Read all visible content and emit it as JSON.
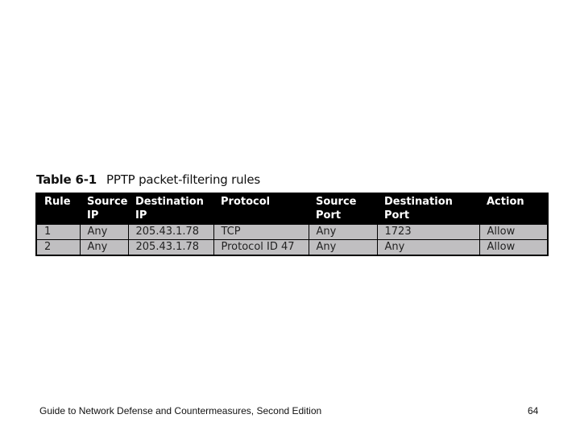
{
  "caption": {
    "number": "Table 6-1",
    "title": "PPTP packet-filtering rules"
  },
  "table": {
    "headers": [
      "Rule",
      "Source IP",
      "Destination IP",
      "Protocol",
      "Source Port",
      "Destination Port",
      "Action"
    ],
    "rows": [
      [
        "1",
        "Any",
        "205.43.1.78",
        "TCP",
        "Any",
        "1723",
        "Allow"
      ],
      [
        "2",
        "Any",
        "205.43.1.78",
        "Protocol ID 47",
        "Any",
        "Any",
        "Allow"
      ]
    ]
  },
  "footer": {
    "text": "Guide to Network Defense and Countermeasures, Second Edition",
    "page_number": "64"
  }
}
